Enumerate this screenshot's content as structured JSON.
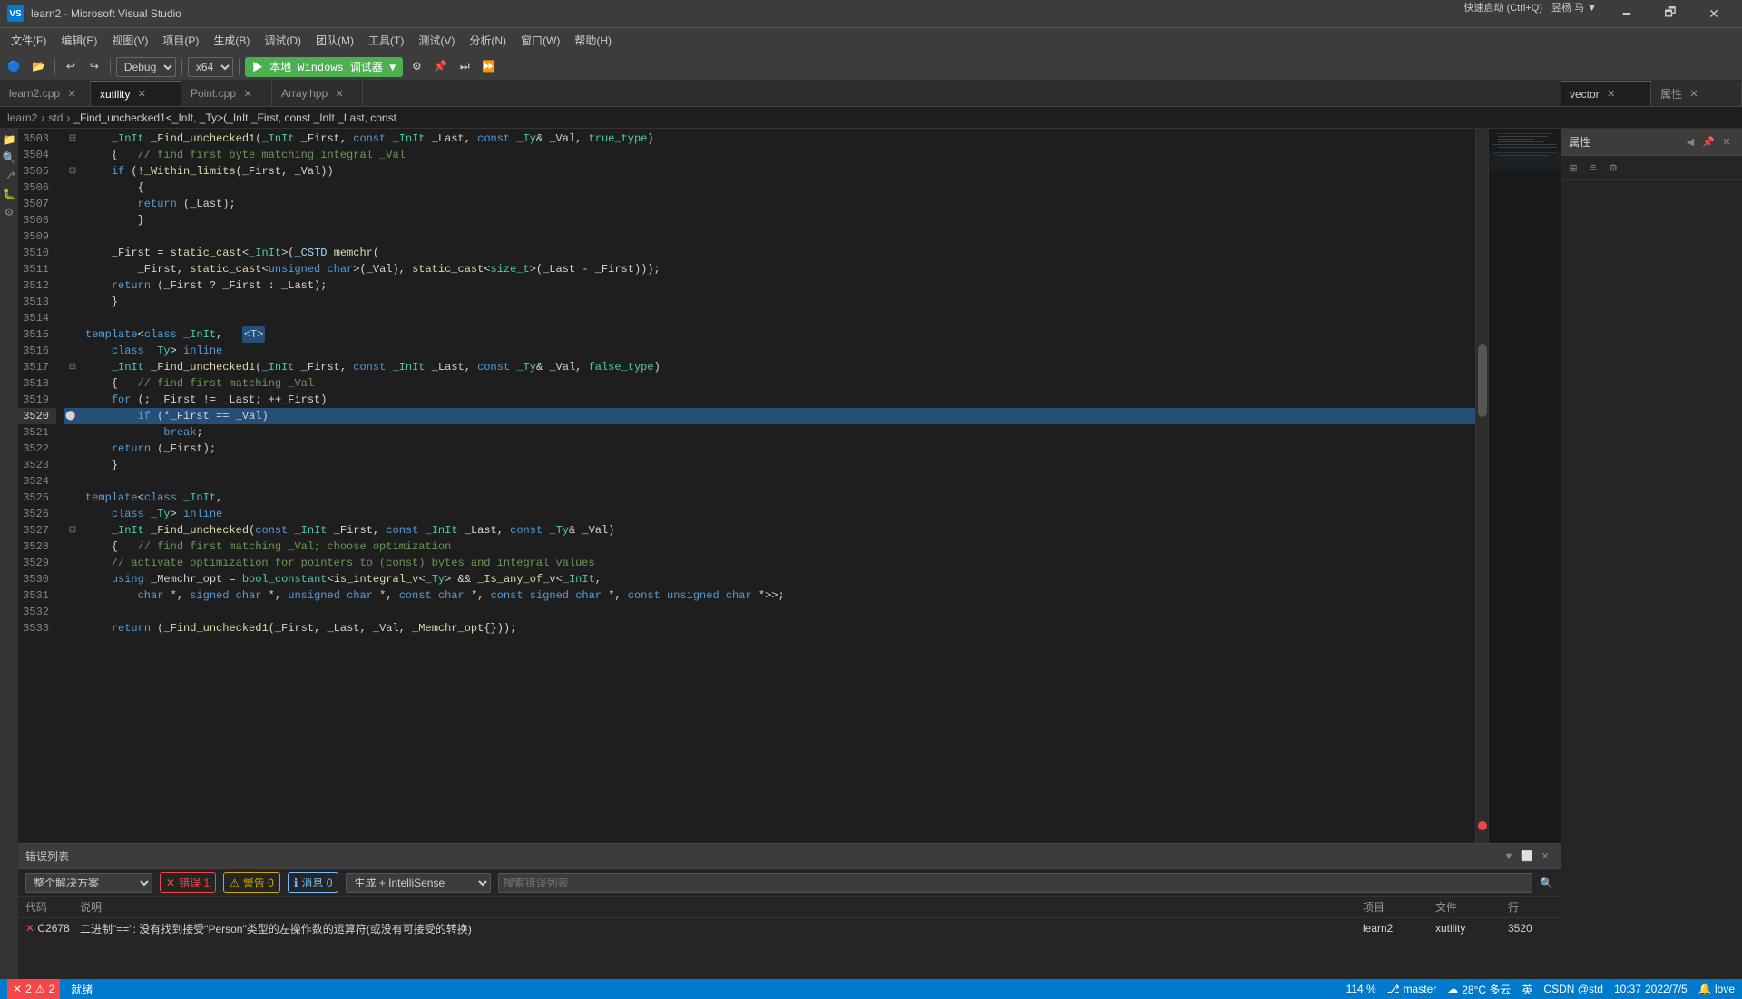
{
  "window": {
    "title": "learn2 - Microsoft Visual Studio",
    "icon": "VS"
  },
  "titlebar": {
    "title": "learn2 - Microsoft Visual Studio",
    "minimize": "🗕",
    "restore": "🗗",
    "close": "✕"
  },
  "menubar": {
    "items": [
      "文件(F)",
      "编辑(E)",
      "视图(V)",
      "项目(P)",
      "生成(B)",
      "调试(D)",
      "团队(M)",
      "工具(T)",
      "测试(V)",
      "分析(N)",
      "窗口(W)",
      "帮助(H)"
    ]
  },
  "toolbar": {
    "debug_config": "Debug",
    "platform": "x64",
    "run_label": "▶ 本地 Windows 调试器 ▼"
  },
  "tabs": {
    "secondary": [
      "learn2.cpp",
      "xutility",
      "Point.cpp",
      "Array.hpp"
    ],
    "active_secondary": "xutility",
    "right_panel": "vector",
    "properties_panel": "属性"
  },
  "breadcrumb": {
    "project": "learn2",
    "namespace": "std",
    "symbol": "_Find_unchecked1<_InIt, _Ty>(_InIt _First, const _InIt _Last, const"
  },
  "code": {
    "lines": [
      {
        "num": 3503,
        "fold": true,
        "content": "    _InIt _Find_unchecked1(_InIt _First, const _InIt _Last, const _Ty& _Val, true_type)",
        "highlighted": false
      },
      {
        "num": 3504,
        "fold": false,
        "content": "    {   // find first byte matching integral _Val",
        "highlighted": false
      },
      {
        "num": 3505,
        "fold": true,
        "content": "    if (!_Within_limits(_First, _Val))",
        "highlighted": false
      },
      {
        "num": 3506,
        "fold": false,
        "content": "        {",
        "highlighted": false
      },
      {
        "num": 3507,
        "fold": false,
        "content": "        return (_Last);",
        "highlighted": false
      },
      {
        "num": 3508,
        "fold": false,
        "content": "        }",
        "highlighted": false
      },
      {
        "num": 3509,
        "fold": false,
        "content": "",
        "highlighted": false
      },
      {
        "num": 3510,
        "fold": false,
        "content": "    _First = static_cast<_InIt>(_CSTD memchr(",
        "highlighted": false
      },
      {
        "num": 3511,
        "fold": false,
        "content": "        _First, static_cast<unsigned char>(_Val), static_cast<size_t>(_Last - _First)));",
        "highlighted": false
      },
      {
        "num": 3512,
        "fold": false,
        "content": "    return (_First ? _First : _Last);",
        "highlighted": false
      },
      {
        "num": 3513,
        "fold": false,
        "content": "    }",
        "highlighted": false
      },
      {
        "num": 3514,
        "fold": false,
        "content": "",
        "highlighted": false
      },
      {
        "num": 3515,
        "fold": false,
        "content": "template<class _InIt,   <T>",
        "highlighted": false,
        "has_template_highlight": true
      },
      {
        "num": 3516,
        "fold": false,
        "content": "    class _Ty> inline",
        "highlighted": false
      },
      {
        "num": 3517,
        "fold": true,
        "content": "    _InIt _Find_unchecked1(_InIt _First, const _InIt _Last, const _Ty& _Val, false_type)",
        "highlighted": false
      },
      {
        "num": 3518,
        "fold": false,
        "content": "    {   // find first matching _Val",
        "highlighted": false
      },
      {
        "num": 3519,
        "fold": false,
        "content": "    for (; _First != _Last; ++_First)",
        "highlighted": false
      },
      {
        "num": 3520,
        "fold": false,
        "content": "        if (*_First == _Val)",
        "highlighted": true,
        "selected": true
      },
      {
        "num": 3521,
        "fold": false,
        "content": "            break;",
        "highlighted": false
      },
      {
        "num": 3522,
        "fold": false,
        "content": "    return (_First);",
        "highlighted": false
      },
      {
        "num": 3523,
        "fold": false,
        "content": "    }",
        "highlighted": false
      },
      {
        "num": 3524,
        "fold": false,
        "content": "",
        "highlighted": false
      },
      {
        "num": 3525,
        "fold": false,
        "content": "template<class _InIt,",
        "highlighted": false
      },
      {
        "num": 3526,
        "fold": false,
        "content": "    class _Ty> inline",
        "highlighted": false
      },
      {
        "num": 3527,
        "fold": true,
        "content": "    _InIt _Find_unchecked(const _InIt _First, const _InIt _Last, const _Ty& _Val)",
        "highlighted": false
      },
      {
        "num": 3528,
        "fold": false,
        "content": "    {   // find first matching _Val; choose optimization",
        "highlighted": false
      },
      {
        "num": 3529,
        "fold": false,
        "content": "    // activate optimization for pointers to (const) bytes and integral values",
        "highlighted": false
      },
      {
        "num": 3530,
        "fold": false,
        "content": "    using _Memchr_opt = bool_constant<is_integral_v<_Ty> && _Is_any_of_v<_InIt,",
        "highlighted": false
      },
      {
        "num": 3531,
        "fold": false,
        "content": "        char *, signed char *, unsigned char *, const char *, const signed char *, const unsigned char *>>;",
        "highlighted": false
      },
      {
        "num": 3532,
        "fold": false,
        "content": "",
        "highlighted": false
      },
      {
        "num": 3533,
        "fold": false,
        "content": "    return (_Find_unchecked1(_First, _Last, _Val, _Memchr_opt{}));",
        "highlighted": false
      }
    ],
    "zoom_level": "114 %"
  },
  "error_panel": {
    "title": "错误列表",
    "error_count": "错误 1",
    "warning_count": "警告 0",
    "info_count": "消息 0",
    "filter_scope": "整个解决方案",
    "build_filter": "生成 + IntelliSense",
    "search_placeholder": "搜索错误列表",
    "columns": [
      "代码",
      "说明",
      "项目",
      "文件",
      "行"
    ],
    "rows": [
      {
        "type": "error",
        "code": "C2678",
        "description": "二进制\"==\": 没有找到接受\"Person\"类型的左操作数的运算符(或没有可接受的转换)",
        "project": "learn2",
        "file": "xutility",
        "line": "3520"
      }
    ]
  },
  "statusbar": {
    "branch_icon": "⎇",
    "branch": "master",
    "errors": "⊘ 2",
    "warnings": "⚠ 2",
    "zoom": "114 %",
    "line_col": "就绪",
    "weather": "28°C 多云",
    "lang": "英",
    "user": "昱杨 马 ▼",
    "time": "10:37",
    "date": "2022/7/5",
    "notifications": "🔔 love",
    "encoding": "CSDN @std"
  },
  "right_panel": {
    "title": "属性"
  }
}
